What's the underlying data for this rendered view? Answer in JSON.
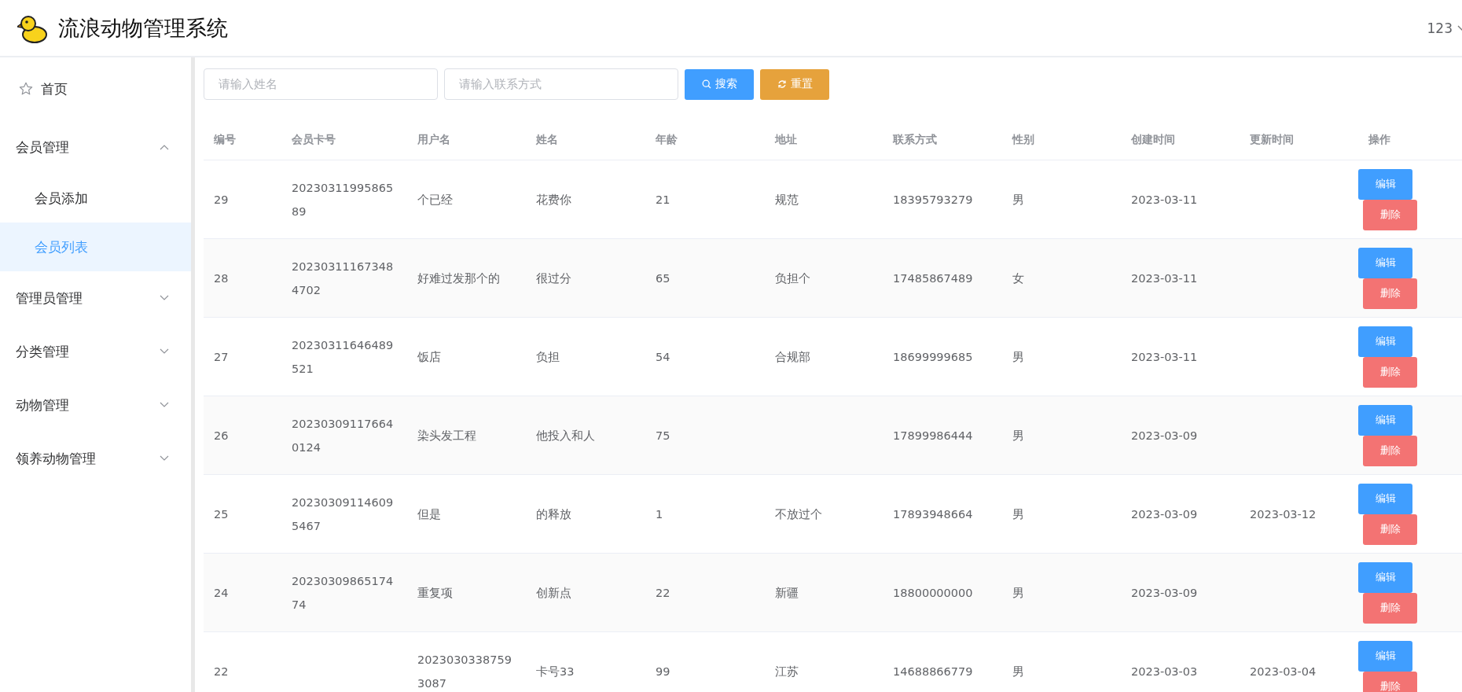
{
  "header": {
    "title": "流浪动物管理系统",
    "user": "123"
  },
  "sidebar": {
    "items": [
      {
        "label": "首页",
        "kind": "link",
        "selected": false
      },
      {
        "label": "会员管理",
        "kind": "group",
        "expanded": true,
        "children": [
          {
            "label": "会员添加",
            "selected": false
          },
          {
            "label": "会员列表",
            "selected": true
          }
        ]
      },
      {
        "label": "管理员管理",
        "kind": "group",
        "expanded": false
      },
      {
        "label": "分类管理",
        "kind": "group",
        "expanded": false
      },
      {
        "label": "动物管理",
        "kind": "group",
        "expanded": false
      },
      {
        "label": "领养动物管理",
        "kind": "group",
        "expanded": false
      }
    ]
  },
  "search": {
    "fields": [
      {
        "placeholder": "请输入姓名"
      },
      {
        "placeholder": "请输入联系方式"
      }
    ],
    "buttons": [
      {
        "label": "搜索",
        "kind": "search"
      },
      {
        "label": "重置",
        "kind": "reset"
      }
    ]
  },
  "table": {
    "columns": [
      "编号",
      "会员卡号",
      "用户名",
      "姓名",
      "年龄",
      "地址",
      "联系方式",
      "性别",
      "创建时间",
      "更新时间",
      "操作"
    ],
    "rows": [
      {
        "cells": [
          "29",
          "2023031199586589",
          "个已经",
          "花费你",
          "21",
          "规范",
          "18395793279",
          "男",
          "2023-03-11",
          ""
        ],
        "actions": [
          "编辑",
          "删除"
        ]
      },
      {
        "cells": [
          "28",
          "202303111673484702",
          "好难过发那个的",
          "很过分",
          "65",
          "负担个",
          "17485867489",
          "女",
          "2023-03-11",
          ""
        ],
        "actions": [
          "编辑",
          "删除"
        ]
      },
      {
        "cells": [
          "27",
          "20230311646489521",
          "饭店",
          "负担",
          "54",
          "合规部",
          "18699999685",
          "男",
          "2023-03-11",
          ""
        ],
        "actions": [
          "编辑",
          "删除"
        ]
      },
      {
        "cells": [
          "26",
          "202303091176640124",
          "染头发工程",
          "他投入和人",
          "75",
          "",
          "17899986444",
          "男",
          "2023-03-09",
          ""
        ],
        "actions": [
          "编辑",
          "删除"
        ]
      },
      {
        "cells": [
          "25",
          "202303091146095467",
          "但是",
          "的释放",
          "1",
          "不放过个",
          "17893948664",
          "男",
          "2023-03-09",
          "2023-03-12"
        ],
        "actions": [
          "编辑",
          "删除"
        ]
      },
      {
        "cells": [
          "24",
          "2023030986517474",
          "重复项",
          "创新点",
          "22",
          "新疆",
          "18800000000",
          "男",
          "2023-03-09",
          ""
        ],
        "actions": [
          "编辑",
          "删除"
        ]
      },
      {
        "cells": [
          "22",
          "",
          "20230303387593087",
          "卡号33",
          "99",
          "江苏",
          "14688866779",
          "男",
          "2023-03-03",
          "2023-03-04"
        ],
        "actions": [
          "编辑",
          "删除"
        ]
      }
    ]
  }
}
